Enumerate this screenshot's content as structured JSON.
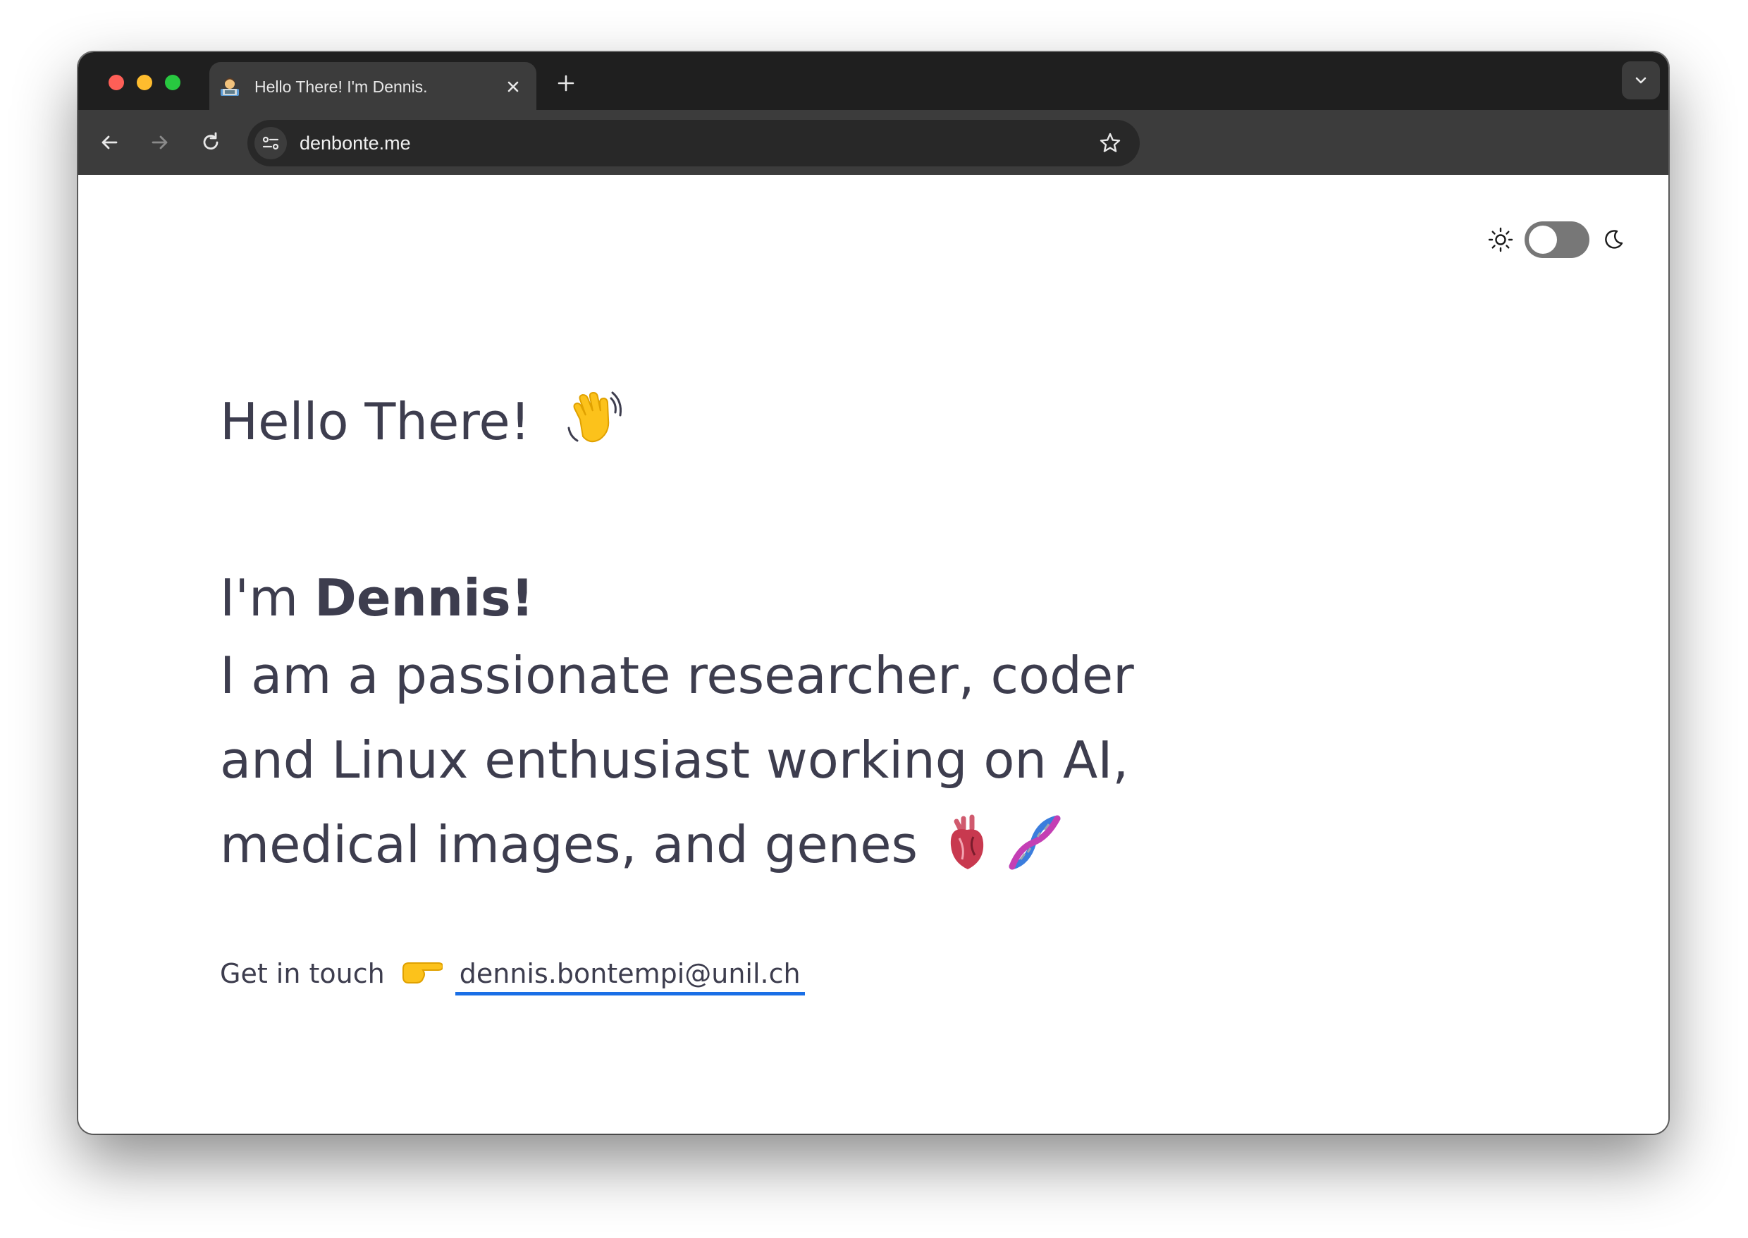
{
  "browser": {
    "tab": {
      "title": "Hello There! I'm Dennis.",
      "favicon": "technologist-emoji"
    },
    "address_bar": {
      "url": "denbonte.me"
    },
    "icons": {
      "close": "close-icon",
      "new_tab": "plus-icon",
      "tab_search": "chevron-down-icon",
      "back": "arrow-left-icon",
      "forward": "arrow-right-icon",
      "reload": "reload-icon",
      "site_info": "tune-icon",
      "bookmark": "star-icon"
    }
  },
  "page": {
    "theme_toggle": {
      "light_icon": "sun-icon",
      "dark_icon": "moon-icon",
      "state": "light"
    },
    "greeting": "Hello There!",
    "greeting_emoji": "waving-hand-emoji",
    "intro_prefix": "I'm ",
    "name": "Dennis!",
    "bio": "I am a passionate researcher, coder and Linux enthusiast working on AI, medical images, and genes",
    "bio_emojis": [
      "anatomical-heart-emoji",
      "dna-emoji"
    ],
    "contact_label": "Get in touch",
    "contact_emoji": "pointing-right-emoji",
    "email": "dennis.bontempi@unil.ch"
  },
  "colors": {
    "text": "#3d3d4e",
    "link_underline": "#1a6fe6",
    "tabbar": "#1f1f1f",
    "toolbar": "#3c3c3c"
  }
}
